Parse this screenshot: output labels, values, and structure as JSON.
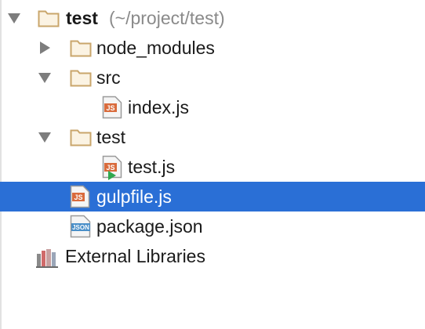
{
  "tree": {
    "root": {
      "label": "test",
      "path": "(~/project/test)",
      "icon": "folder-icon"
    },
    "items": [
      {
        "label": "node_modules",
        "icon": "folder-icon",
        "expanded": false
      },
      {
        "label": "src",
        "icon": "folder-icon",
        "expanded": true
      },
      {
        "label": "index.js",
        "icon": "js-file-icon",
        "badge": "JS"
      },
      {
        "label": "test",
        "icon": "folder-icon",
        "expanded": true
      },
      {
        "label": "test.js",
        "icon": "js-test-file-icon",
        "badge": "JS"
      },
      {
        "label": "gulpfile.js",
        "icon": "js-file-icon",
        "badge": "JS",
        "selected": true
      },
      {
        "label": "package.json",
        "icon": "json-file-icon",
        "badge": "JSON"
      },
      {
        "label": "External Libraries",
        "icon": "libraries-icon"
      }
    ]
  },
  "colors": {
    "selection": "#2a6fd6",
    "folder": "#c9a66b",
    "js_badge": "#d96b3c",
    "json_badge": "#4a8fc8"
  }
}
